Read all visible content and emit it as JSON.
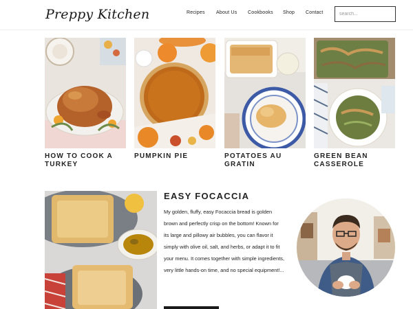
{
  "header": {
    "logo": "Preppy Kitchen",
    "nav": [
      "Recipes",
      "About Us",
      "Cookbooks",
      "Shop",
      "Contact"
    ],
    "search_placeholder": "search..."
  },
  "recipes": [
    {
      "title": "HOW TO COOK A TURKEY"
    },
    {
      "title": "PUMPKIN PIE"
    },
    {
      "title": "POTATOES AU GRATIN"
    },
    {
      "title": "GREEN BEAN CASSEROLE"
    }
  ],
  "feature": {
    "title": "EASY FOCACCIA",
    "description": "My golden, fluffy, easy Focaccia bread is golden brown and perfectly crisp on the bottom! Known for its large and pillowy air bubbles, you can flavor it simply with olive oil, salt, and herbs, or adapt it to fit your menu. It comes together with simple ingredients, very little hands-on time, and no special equipment!..."
  },
  "colors": {
    "text": "#222222",
    "accent": "#1a1a1a"
  }
}
